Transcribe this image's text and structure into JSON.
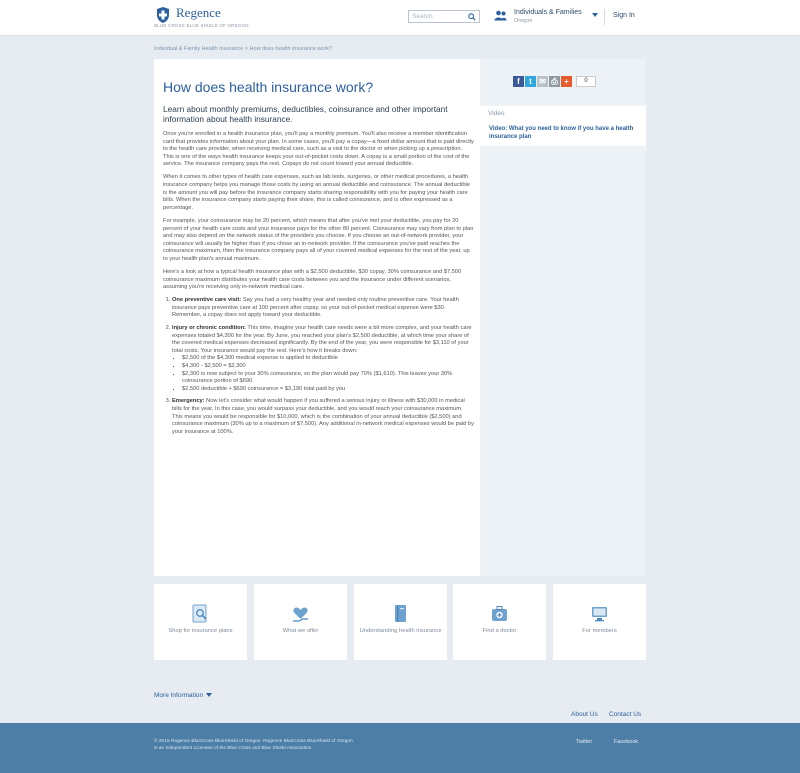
{
  "header": {
    "brand": "Regence",
    "brand_sub": "BLUE CROSS BLUE SHIELD OF OREGON",
    "search_placeholder": "Search",
    "market_title": "Individuals & Families",
    "market_sub": "Oregon",
    "signin": "Sign In"
  },
  "breadcrumb": "Individual & Family Health Insurance > How does health insurance work?",
  "article": {
    "title": "How does health insurance work?",
    "intro": "Learn about monthly premiums, deductibles, coinsurance and other important information about health insurance.",
    "p1": "Once you're enrolled in a health insurance plan, you'll pay a monthly premium. You'll also receive a member identification card that provides information about your plan. In some cases, you'll pay a copay—a fixed dollar amount that is paid directly to the health care provider, when receiving medical care, such as a visit to the doctor or when picking up a prescription. This is one of the ways health insurance keeps your out-of-pocket costs down. A copay is a small portion of the cost of the service. The insurance company pays the rest. Copays do not count toward your annual deductible.",
    "p2": "When it comes to other types of health care expenses, such as lab tests, surgeries, or other medical procedures, a health insurance company helps you manage those costs by using an annual deductible and coinsurance. The annual deductible is the amount you will pay before the insurance company starts sharing responsibility with you for paying your health care bills. When the insurance company starts paying their share, this is called coinsurance, and is often expressed as a percentage.",
    "p3": "For example, your coinsurance may be 20 percent, which means that after you've met your deductible, you pay for 20 percent of your health care costs and your insurance pays for the other 80 percent. Coinsurance may vary from plan to plan and may also depend on the network status of the providers you choose. If you choose an out-of-network provider, your coinsurance will usually be higher than if you chose an in-network provider. If the coinsurance you've paid reaches the coinsurance maximum, then the insurance company pays all of your covered medical expenses for the rest of the year, up to your health plan's annual maximum.",
    "p4": "Here's a look at how a typical health insurance plan with a $2,500 deductible, $30 copay, 30% coinsurance and $7,500 coinsurance maximum distributes your health care costs between you and the insurance under different scenarios, assuming you're receiving only in-network medical care.",
    "items": [
      {
        "title": "One preventive care visit:",
        "text": " Say you had a very healthy year and needed only routine preventive care. Your health insurance pays preventive care at 100 percent after copay, so your out-of-pocket medical expense were $30. Remember, a copay does not apply toward your deductible."
      },
      {
        "title": "Injury or chronic condition:",
        "text": " This time, imagine your health care needs were a bit more complex, and your health care expenses totaled $4,300 for the year. By June, you reached your plan's $2,500 deductible, at which time your share of the covered medical expenses decreased significantly. By the end of the year, you were responsible for $3,110 of your total costs. Your insurance would pay the rest. Here's how it breaks down:",
        "bullets": [
          "$2,500 of the $4,300 medical expense is applied to deductible",
          "$4,300 - $2,500 = $2,300",
          "$2,300 is now subject to your 30% coinsurance, so the plan would pay 70% ($1,610). This leaves your 30% coinsurance portion of $690.",
          "$2,500 deductible + $690 coinsurance = $3,190 total paid by you"
        ]
      },
      {
        "title": "Emergency:",
        "text": " Now let's consider what would happen if you suffered a serious injury or illness with $30,000 in medical bills for the year. In this case, you would surpass your deductible, and you would reach your coinsurance maximum. This means you would be responsible for $10,000, which is the combination of your annual deductible ($2,500) and coinsurance maximum (30% up to a maximum of $7,500). Any additional in-network medical expenses would be paid by your insurance at 100%."
      }
    ]
  },
  "sidebar": {
    "share_count": "0",
    "video_heading": "Video",
    "video_link": "Video: What you need to know if you have a health insurance plan"
  },
  "tiles": [
    {
      "label": "Shop for insurance plans",
      "icon": "search-document-icon"
    },
    {
      "label": "What we offer",
      "icon": "heart-hand-icon"
    },
    {
      "label": "Understanding health insurance",
      "icon": "book-icon"
    },
    {
      "label": "Find a doctor",
      "icon": "medical-kit-icon"
    },
    {
      "label": "For members",
      "icon": "computer-icon"
    }
  ],
  "links": {
    "more_info": "More Information",
    "about_us": "About Us",
    "contact_us": "Contact Us"
  },
  "footer": {
    "copyright": "© 2015 Regence BlueCross BlueShield of Oregon. Regence BlueCross BlueShield of Oregon",
    "license": "is an Independent Licensee of the Blue Cross and Blue Shield Association.",
    "twitter": "Twitter",
    "facebook": "Facebook"
  },
  "colors": {
    "brand_blue": "#2b5f9e",
    "footer_blue": "#4d7ea6",
    "page_bg": "#e6ecf1"
  }
}
